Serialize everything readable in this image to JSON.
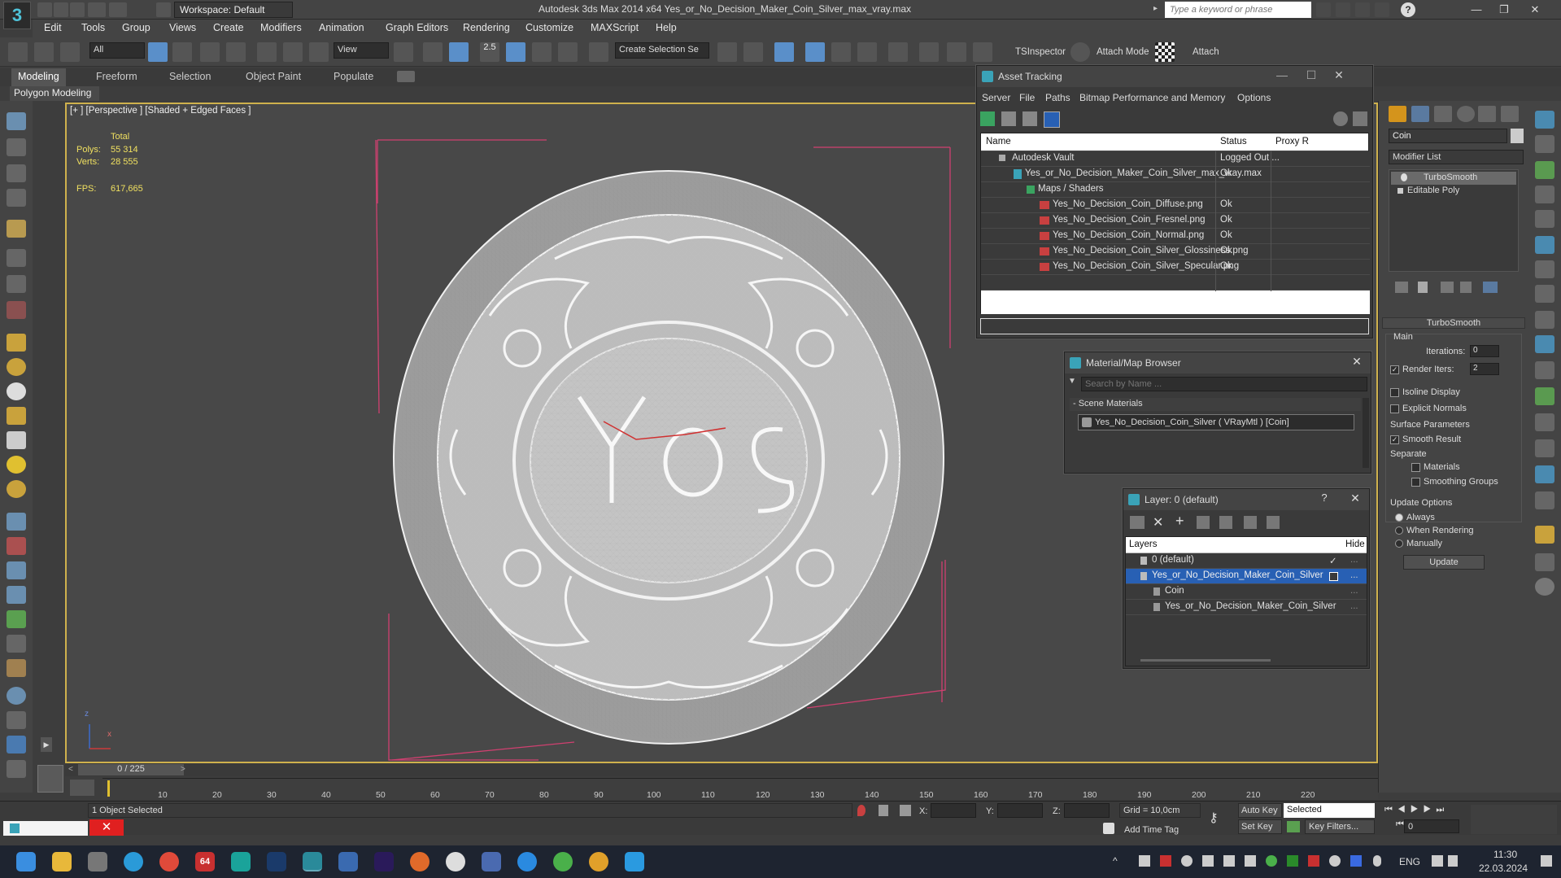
{
  "app": {
    "title": "Autodesk 3ds Max  2014 x64     Yes_or_No_Decision_Maker_Coin_Silver_max_vray.max",
    "workspace": "Workspace: Default",
    "keyword_placeholder": "Type a keyword or phrase",
    "logo_glyph": "3"
  },
  "menu": [
    "Edit",
    "Tools",
    "Group",
    "Views",
    "Create",
    "Modifiers",
    "Animation",
    "Graph Editors",
    "Rendering",
    "Customize",
    "MAXScript",
    "Help"
  ],
  "toolbar": {
    "filter_value": "All",
    "ref_coord_value": "View",
    "snap_label": "2.5",
    "selection_set_placeholder": "Create Selection Se",
    "tsinspector_label": "TSInspector",
    "attach_mode_label": "Attach Mode",
    "attach_label": "Attach"
  },
  "ribbon": {
    "tabs": [
      "Modeling",
      "Freeform",
      "Selection",
      "Object Paint",
      "Populate"
    ],
    "active_tab": "Modeling",
    "panel_label": "Polygon Modeling"
  },
  "viewport": {
    "label": "[+ ] [Perspective ] [Shaded + Edged Faces ]",
    "stats": {
      "total_label": "Total",
      "polys_label": "Polys:",
      "polys_value": "55 314",
      "verts_label": "Verts:",
      "verts_value": "28 555",
      "fps_label": "FPS:",
      "fps_value": "617,665"
    },
    "axis_z": "z",
    "axis_x": "x"
  },
  "asset_tracking": {
    "title": "Asset Tracking",
    "menu": [
      "Server",
      "File",
      "Paths",
      "Bitmap Performance and Memory",
      "Options"
    ],
    "columns": [
      "Name",
      "Status",
      "Proxy R"
    ],
    "rows": [
      {
        "name": "Autodesk Vault",
        "status": "Logged Out ..."
      },
      {
        "name": "Yes_or_No_Decision_Maker_Coin_Silver_max_vray.max",
        "status": "Ok"
      },
      {
        "name": "Maps / Shaders",
        "status": ""
      },
      {
        "name": "Yes_No_Decision_Coin_Diffuse.png",
        "status": "Ok"
      },
      {
        "name": "Yes_No_Decision_Coin_Fresnel.png",
        "status": "Ok"
      },
      {
        "name": "Yes_No_Decision_Coin_Normal.png",
        "status": "Ok"
      },
      {
        "name": "Yes_No_Decision_Coin_Silver_Glossiness.png",
        "status": "Ok"
      },
      {
        "name": "Yes_No_Decision_Coin_Silver_Specular.png",
        "status": "Ok"
      }
    ]
  },
  "material_browser": {
    "title": "Material/Map Browser",
    "search_placeholder": "Search by Name ...",
    "section": "- Scene Materials",
    "material": "Yes_No_Decision_Coin_Silver  ( VRayMtl ) [Coin]"
  },
  "layers": {
    "title": "Layer: 0 (default)",
    "help": "?",
    "col_layers": "Layers",
    "col_hide": "Hide",
    "rows": [
      {
        "name": "0 (default)",
        "selected": false
      },
      {
        "name": "Yes_or_No_Decision_Maker_Coin_Silver",
        "selected": true
      },
      {
        "name": "Coin",
        "selected": false
      },
      {
        "name": "Yes_or_No_Decision_Maker_Coin_Silver",
        "selected": false
      }
    ]
  },
  "command_panel": {
    "object_name": "Coin",
    "modifier_list": "Modifier List",
    "stack": [
      "TurboSmooth",
      "Editable Poly"
    ],
    "rollout_title": "TurboSmooth",
    "main_label": "Main",
    "iterations_label": "Iterations:",
    "iterations_value": "0",
    "render_iters_label": "Render Iters:",
    "render_iters_value": "2",
    "isoline_label": "Isoline Display",
    "explicit_normals_label": "Explicit Normals",
    "surface_params_label": "Surface Parameters",
    "smooth_result_label": "Smooth Result",
    "separate_label": "Separate",
    "materials_label": "Materials",
    "smoothing_groups_label": "Smoothing Groups",
    "update_options_label": "Update Options",
    "always_label": "Always",
    "when_rendering_label": "When Rendering",
    "manually_label": "Manually",
    "update_button": "Update"
  },
  "timeline": {
    "frame_display": "0 / 225",
    "ticks": [
      "10",
      "20",
      "30",
      "40",
      "50",
      "60",
      "70",
      "80",
      "90",
      "100",
      "110",
      "120",
      "130",
      "140",
      "150",
      "160",
      "170",
      "180",
      "190",
      "200",
      "210",
      "220"
    ]
  },
  "status": {
    "selection": "1 Object Selected",
    "x_label": "X:",
    "y_label": "Y:",
    "z_label": "Z:",
    "grid": "Grid = 10,0cm",
    "add_time_tag": "Add Time Tag",
    "auto_key": "Auto Key",
    "set_key": "Set Key",
    "key_mode_value": "Selected",
    "key_filters": "Key Filters...",
    "current_frame": "0"
  },
  "taskbar": {
    "lang": "ENG",
    "time": "11:30",
    "date": "22.03.2024",
    "badge": "64"
  },
  "colors": {
    "accent": "#2860b4",
    "viewport_border": "#cfb14d",
    "bounding_box": "#d04070",
    "wire": "#e6e6e6"
  }
}
